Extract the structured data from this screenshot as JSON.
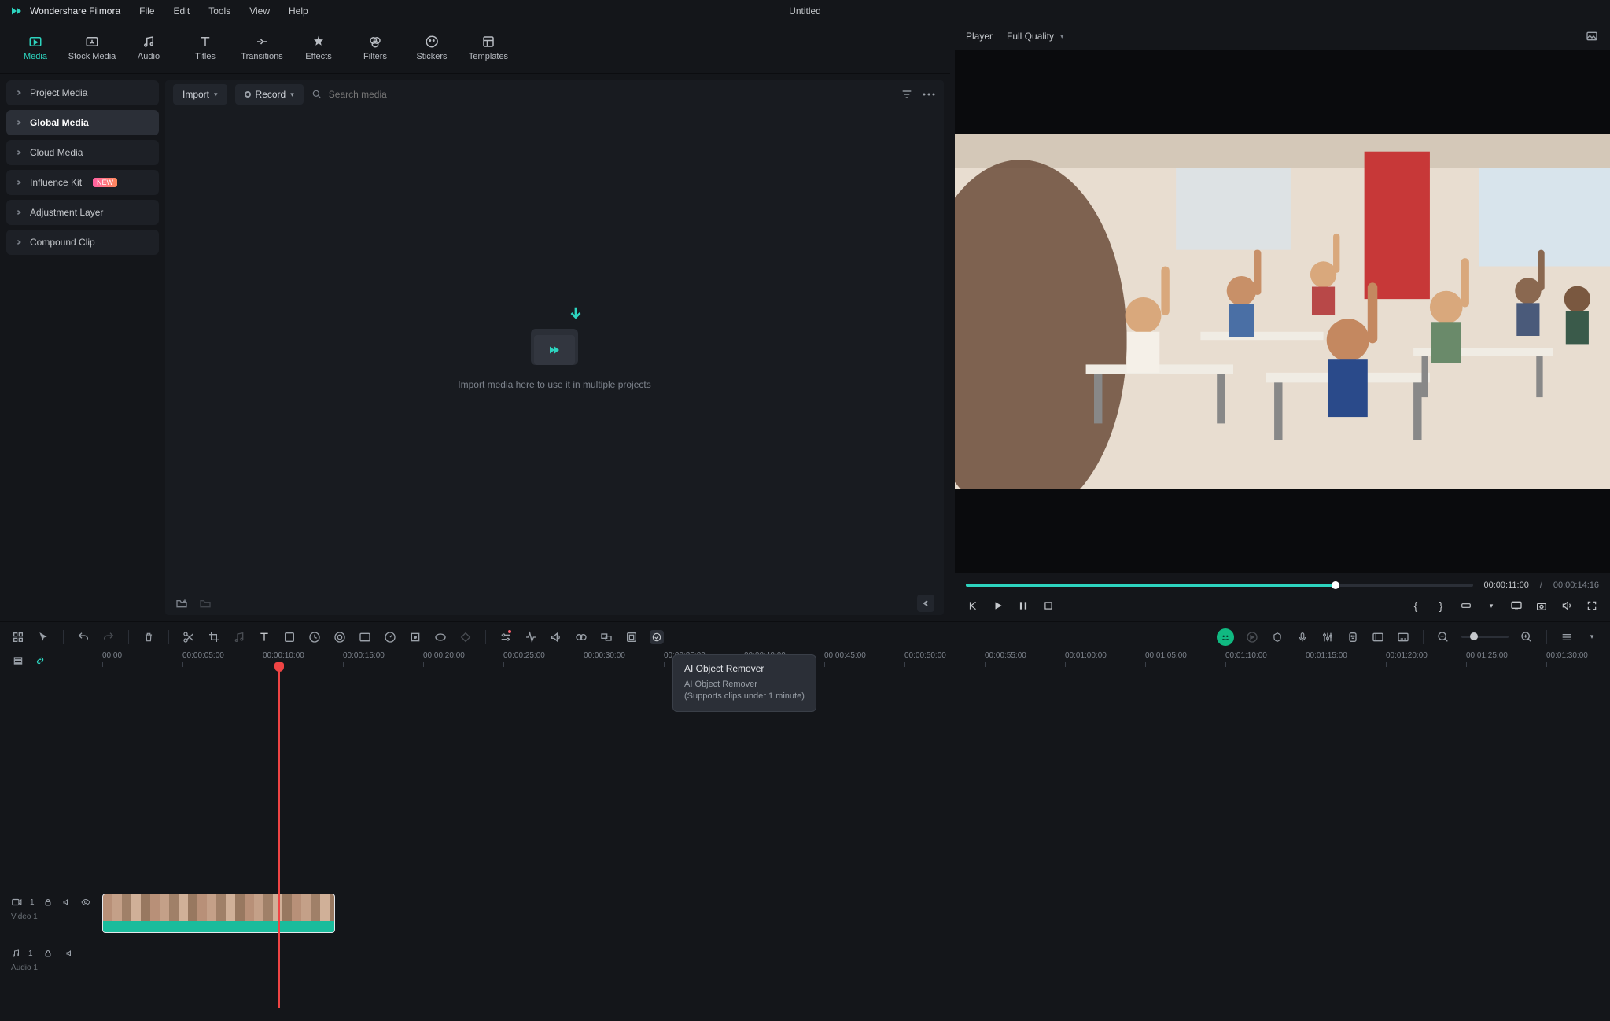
{
  "app": {
    "name": "Wondershare Filmora",
    "project_title": "Untitled"
  },
  "menus": [
    "File",
    "Edit",
    "Tools",
    "View",
    "Help"
  ],
  "top_tabs": [
    {
      "label": "Media",
      "icon": "media"
    },
    {
      "label": "Stock Media",
      "icon": "stock"
    },
    {
      "label": "Audio",
      "icon": "audio"
    },
    {
      "label": "Titles",
      "icon": "titles"
    },
    {
      "label": "Transitions",
      "icon": "transitions"
    },
    {
      "label": "Effects",
      "icon": "effects"
    },
    {
      "label": "Filters",
      "icon": "filters"
    },
    {
      "label": "Stickers",
      "icon": "stickers"
    },
    {
      "label": "Templates",
      "icon": "templates"
    }
  ],
  "active_top_tab": 0,
  "media_sidebar": [
    {
      "label": "Project Media"
    },
    {
      "label": "Global Media",
      "active": true
    },
    {
      "label": "Cloud Media"
    },
    {
      "label": "Influence Kit",
      "badge": "NEW"
    },
    {
      "label": "Adjustment Layer"
    },
    {
      "label": "Compound Clip"
    }
  ],
  "media_toolbar": {
    "import_label": "Import",
    "record_label": "Record",
    "search_placeholder": "Search media"
  },
  "media_empty_text": "Import media here to use it in multiple projects",
  "player": {
    "label": "Player",
    "quality": "Full Quality",
    "time_current": "00:00:11:00",
    "time_separator": "/",
    "time_total": "00:00:14:16"
  },
  "timeline": {
    "tick_interval_seconds": 5,
    "tick_count": 19,
    "tick_prefix": "00:",
    "playhead_seconds": 11,
    "tracks": {
      "video": {
        "name": "Video 1",
        "badge": "1"
      },
      "audio": {
        "name": "Audio 1",
        "badge": "1"
      }
    },
    "clip": {
      "start_seconds": 0,
      "duration_seconds": 14.5
    }
  },
  "tooltip": {
    "title": "AI Object Remover",
    "line1": "AI Object Remover",
    "line2": "(Supports clips under 1 minute)"
  }
}
